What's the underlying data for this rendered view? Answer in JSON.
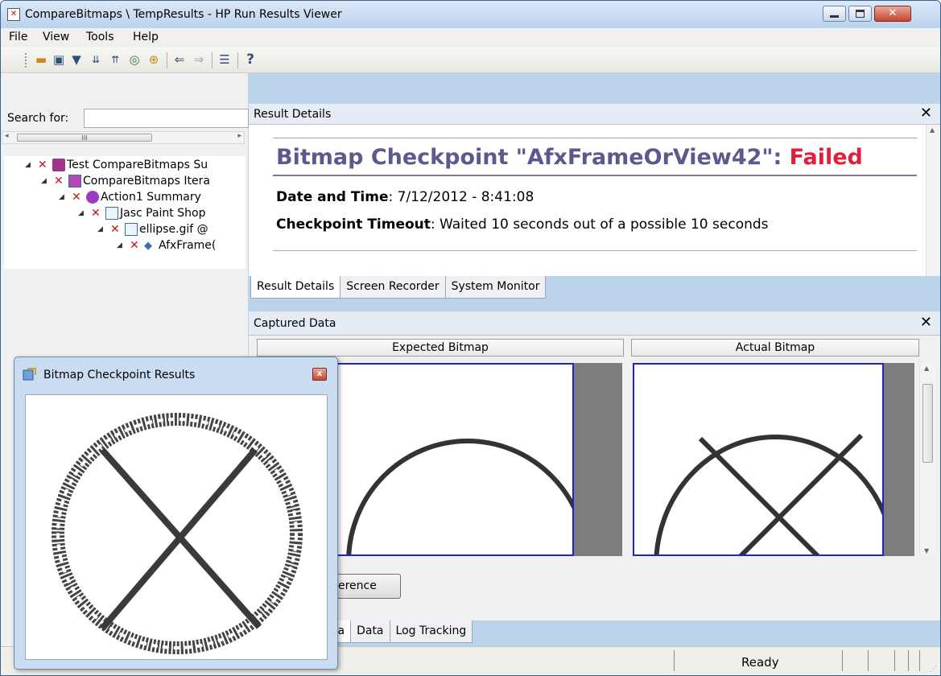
{
  "window": {
    "title": "CompareBitmaps \\ TempResults - HP Run Results Viewer",
    "icon": "app-results-icon",
    "buttons": [
      "minimize",
      "maximize",
      "close"
    ]
  },
  "menu": [
    "File",
    "View",
    "Tools",
    "Help"
  ],
  "toolbar": {
    "icons": [
      "open-folder-icon",
      "print-icon",
      "filter-icon",
      "expand-all-icon",
      "collapse-all-icon",
      "find-icon",
      "add-icon",
      "back-icon",
      "forward-icon",
      "list-icon",
      "help-icon"
    ]
  },
  "search": {
    "label": "Search for:",
    "value": ""
  },
  "tree": {
    "scroll_thumb": "III",
    "nodes": [
      {
        "label": "Test CompareBitmaps Su",
        "status": "failed",
        "icon": "test-icon"
      },
      {
        "label": "CompareBitmaps Itera",
        "status": "failed",
        "icon": "iteration-icon"
      },
      {
        "label": "Action1 Summary",
        "status": "failed",
        "icon": "action-icon"
      },
      {
        "label": "Jasc Paint Shop",
        "status": "failed",
        "icon": "window-icon"
      },
      {
        "label": "ellipse.gif @",
        "status": "failed",
        "icon": "window-icon"
      },
      {
        "label": "AfxFrame(",
        "status": "failed",
        "icon": "checkpoint-icon"
      }
    ]
  },
  "result_details": {
    "header": "Result Details",
    "heading": "Bitmap Checkpoint \"AfxFrameOrView42\": ",
    "status": "Failed",
    "date_label": "Date and Time",
    "date_value": ": 7/12/2012 - 8:41:08",
    "timeout_label": "Checkpoint Timeout",
    "timeout_value": ": Waited 10 seconds out of a possible 10 seconds",
    "tabs": [
      "Result Details",
      "Screen Recorder",
      "System Monitor"
    ],
    "active_tab": "Result Details"
  },
  "captured": {
    "header": "Captured Data",
    "expected_label": "Expected Bitmap",
    "actual_label": "Actual Bitmap",
    "diff_button": "erence",
    "tabs": [
      "ta",
      "Data",
      "Log Tracking"
    ]
  },
  "status_bar": {
    "text": "Ready"
  },
  "popup": {
    "title": "Bitmap Checkpoint Results",
    "close": "x"
  },
  "colors": {
    "failed": "#e0203a",
    "heading": "#5a5a8e",
    "frame_border": "#2222cc"
  }
}
